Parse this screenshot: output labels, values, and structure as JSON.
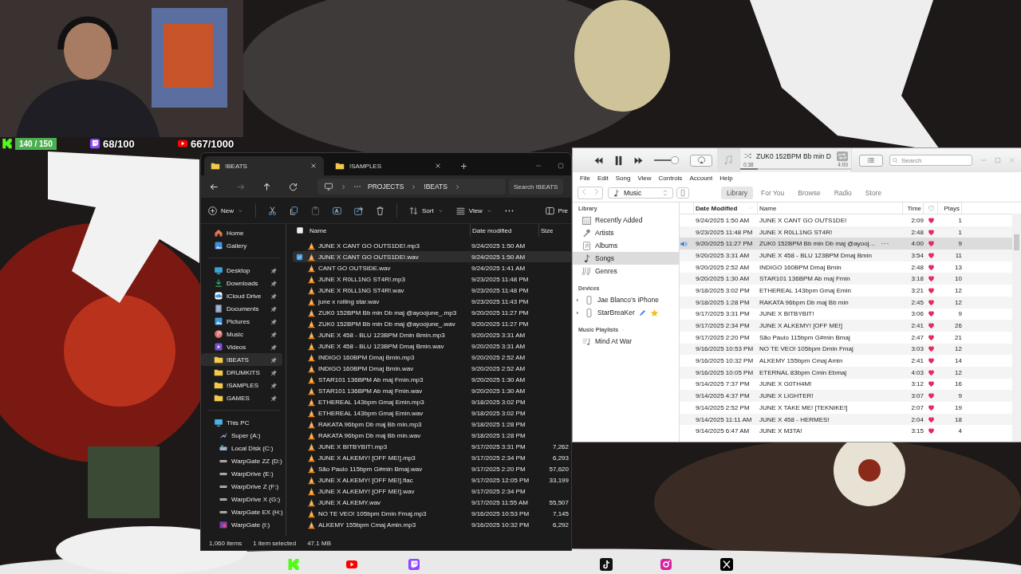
{
  "stream": {
    "goals": [
      {
        "kind": "kick",
        "count": "140 / 150"
      },
      {
        "kind": "twitch",
        "count": "68/100"
      },
      {
        "kind": "youtube",
        "count": "667/1000"
      }
    ],
    "socials": [
      {
        "kind": "kick"
      },
      {
        "kind": "youtube"
      },
      {
        "kind": "twitch"
      },
      {
        "kind": "tiktok"
      },
      {
        "kind": "instagram"
      },
      {
        "kind": "x"
      }
    ]
  },
  "explorer": {
    "tabs": [
      {
        "label": "!BEATS",
        "selected": true
      },
      {
        "label": "!SAMPLES",
        "selected": false
      }
    ],
    "breadcrumb": [
      "PROJECTS",
      "!BEATS"
    ],
    "search": {
      "placeholder": "Search !BEATS"
    },
    "toolbar": {
      "new": "New",
      "sort": "Sort",
      "view": "View",
      "preview": "Pre"
    },
    "columns": [
      "Name",
      "Date modified",
      "Size"
    ],
    "sidebar": [
      {
        "items": [
          {
            "label": "Home",
            "kind": "home",
            "pinned": false,
            "selected": false
          },
          {
            "label": "Gallery",
            "kind": "gallery",
            "pinned": false,
            "selected": false
          }
        ]
      },
      {
        "items": [
          {
            "label": "Desktop",
            "kind": "desktop",
            "pinned": true,
            "selected": false
          },
          {
            "label": "Downloads",
            "kind": "downloads",
            "pinned": true,
            "selected": false
          },
          {
            "label": "iCloud Drive",
            "kind": "cloud",
            "pinned": true,
            "selected": false
          },
          {
            "label": "Documents",
            "kind": "documents",
            "pinned": true,
            "selected": false
          },
          {
            "label": "Pictures",
            "kind": "pictures",
            "pinned": true,
            "selected": false
          },
          {
            "label": "Music",
            "kind": "music",
            "pinned": true,
            "selected": false
          },
          {
            "label": "Videos",
            "kind": "videos",
            "pinned": true,
            "selected": false
          },
          {
            "label": "!BEATS",
            "kind": "folder",
            "pinned": true,
            "selected": true
          },
          {
            "label": "DRUMKITS",
            "kind": "folder",
            "pinned": true,
            "selected": false
          },
          {
            "label": "!SAMPLES",
            "kind": "folder",
            "pinned": true,
            "selected": false
          },
          {
            "label": "GAMES",
            "kind": "folder",
            "pinned": true,
            "selected": false
          }
        ]
      },
      {
        "items": [
          {
            "label": "This PC",
            "kind": "pc",
            "selected": false,
            "children": [
              {
                "label": "Super (A:)",
                "kind": "special",
                "selected": false
              },
              {
                "label": "Local Disk (C:)",
                "kind": "disk",
                "selected": false
              },
              {
                "label": "WarpGate ZZ (D:)",
                "kind": "drive",
                "selected": false
              },
              {
                "label": "WarpDrive (E:)",
                "kind": "drive",
                "selected": false
              },
              {
                "label": "WarpDrive Z (F:)",
                "kind": "drive",
                "selected": false
              },
              {
                "label": "WarpDrive X (G:)",
                "kind": "drive",
                "selected": false
              },
              {
                "label": "WarpGate EX (H:)",
                "kind": "drive",
                "selected": false
              },
              {
                "label": "WarpGate (I:)",
                "kind": "app",
                "selected": false
              }
            ]
          }
        ]
      }
    ],
    "files": [
      {
        "name": "JUNE X CANT GO OUTS1DE!.mp3",
        "date": "9/24/2025 1:50 AM",
        "selected": false
      },
      {
        "name": "JUNE X CANT GO OUTS1DE!.wav",
        "date": "9/24/2025 1:50 AM",
        "selected": true
      },
      {
        "name": "CANT GO OUTSIDE.wav",
        "date": "9/24/2025 1:41 AM",
        "selected": false
      },
      {
        "name": "JUNE X R0LL1NG ST4R!.mp3",
        "date": "9/23/2025 11:48 PM",
        "selected": false
      },
      {
        "name": "JUNE X R0LL1NG ST4R!.wav",
        "date": "9/23/2025 11:48 PM",
        "selected": false
      },
      {
        "name": "june x rolling star.wav",
        "date": "9/23/2025 11:43 PM",
        "selected": false
      },
      {
        "name": "ZUK0 152BPM Bb min Db maj @ayoojune_.mp3",
        "date": "9/20/2025 11:27 PM",
        "selected": false
      },
      {
        "name": "ZUK0 152BPM Bb min Db maj @ayoojune_.wav",
        "date": "9/20/2025 11:27 PM",
        "selected": false
      },
      {
        "name": "JUNE X 458 - BLU 123BPM Dmin Bmin.mp3",
        "date": "9/20/2025 3:31 AM",
        "selected": false
      },
      {
        "name": "JUNE X 458 - BLU 123BPM Dmaj Bmin.wav",
        "date": "9/20/2025 3:31 AM",
        "selected": false
      },
      {
        "name": "INDIGO 160BPM Dmaj Bmin.mp3",
        "date": "9/20/2025 2:52 AM",
        "selected": false
      },
      {
        "name": "INDIGO 160BPM Dmaj Bmin.wav",
        "date": "9/20/2025 2:52 AM",
        "selected": false
      },
      {
        "name": "STAR101 136BPM Ab maj Fmin.mp3",
        "date": "9/20/2025 1:30 AM",
        "selected": false
      },
      {
        "name": "STAR101 136BPM Ab maj Fmin.wav",
        "date": "9/20/2025 1:30 AM",
        "selected": false
      },
      {
        "name": "ETHEREAL 143bpm Gmaj Emin.mp3",
        "date": "9/18/2025 3:02 PM",
        "selected": false
      },
      {
        "name": "ETHEREAL 143bpm Gmaj Emin.wav",
        "date": "9/18/2025 3:02 PM",
        "selected": false
      },
      {
        "name": "RAKATA 96bpm Db maj Bb min.mp3",
        "date": "9/18/2025 1:28 PM",
        "selected": false
      },
      {
        "name": "RAKATA 96bpm Db maj Bb min.wav",
        "date": "9/18/2025 1:28 PM",
        "selected": false
      },
      {
        "name": "JUNE X BITBYBIT!.mp3",
        "date": "9/17/2025 3:31 PM",
        "size": "7,262",
        "selected": false
      },
      {
        "name": "JUNE X ALKEMY! [OFF ME!].mp3",
        "date": "9/17/2025 2:34 PM",
        "size": "6,293",
        "selected": false
      },
      {
        "name": "São Paulo 115bpm G#min Bmaj.wav",
        "date": "9/17/2025 2:20 PM",
        "size": "57,620",
        "selected": false
      },
      {
        "name": "JUNE X ALKEMY! [OFF ME!].flac",
        "date": "9/17/2025 12:05 PM",
        "size": "33,199",
        "selected": false
      },
      {
        "name": "JUNE X ALKEMY! [OFF ME!].wav",
        "date": "9/17/2025 2:34 PM",
        "selected": false
      },
      {
        "name": "JUNE X ALKEMY.wav",
        "date": "9/17/2025 11:55 AM",
        "size": "55,507",
        "selected": false
      },
      {
        "name": "NO TE VEO! 105bpm Dmin Fmaj.mp3",
        "date": "9/16/2025 10:53 PM",
        "size": "7,145",
        "selected": false
      },
      {
        "name": "ALKEMY 155bpm Cmaj Amin.mp3",
        "date": "9/16/2025 10:32 PM",
        "size": "6,292",
        "selected": false
      }
    ],
    "status": [
      "1,060 items",
      "1 item selected",
      "47.1 MB"
    ]
  },
  "itunes": {
    "volume": {
      "level": 0.85
    },
    "now_playing": {
      "title": "ZUK0 152BPM Bb min D",
      "elapsed": "0:38",
      "total": "4:00",
      "level": 0.16
    },
    "search": {
      "placeholder": "Search"
    },
    "menu": [
      "File",
      "Edit",
      "Song",
      "View",
      "Controls",
      "Account",
      "Help"
    ],
    "source": "Music",
    "tabs": [
      {
        "label": "Library",
        "selected": true
      },
      {
        "label": "For You",
        "selected": false
      },
      {
        "label": "Browse",
        "selected": false
      },
      {
        "label": "Radio",
        "selected": false
      },
      {
        "label": "Store",
        "selected": false
      }
    ],
    "sidebar": [
      {
        "heading": "Library",
        "items": [
          {
            "label": "Recently Added",
            "kind": "recent",
            "selected": false
          },
          {
            "label": "Artists",
            "kind": "artists",
            "selected": false
          },
          {
            "label": "Albums",
            "kind": "albums",
            "selected": false
          },
          {
            "label": "Songs",
            "kind": "songs",
            "selected": true
          },
          {
            "label": "Genres",
            "kind": "genres",
            "selected": false
          }
        ]
      },
      {
        "heading": "Devices",
        "items": [
          {
            "label": "Jae Blanco’s iPhone",
            "kind": "device",
            "expanded": false,
            "emoji_icons": false,
            "selected": false
          },
          {
            "label": "StarBreaKer",
            "kind": "device",
            "expanded": false,
            "emoji_icons": true,
            "selected": false
          }
        ]
      },
      {
        "heading": "Music Playlists",
        "collapsible": true,
        "items": [
          {
            "label": "Mind At War",
            "kind": "playlist",
            "selected": false
          }
        ]
      }
    ],
    "columns": [
      {
        "label": "Date Modified",
        "sorted": true
      },
      {
        "label": "Name",
        "sorted": false
      },
      {
        "label": "Time",
        "sorted": false
      },
      {
        "label": "Plays",
        "sorted": false
      }
    ],
    "songs": [
      {
        "date": "9/24/2025 1:50 AM",
        "name": "JUNE X CANT GO OUTS1DE!",
        "time": "2:09",
        "loved": true,
        "plays": "1",
        "playing": false
      },
      {
        "date": "9/23/2025 11:48 PM",
        "name": "JUNE X R0LL1NG ST4R!",
        "time": "2:48",
        "loved": true,
        "plays": "1",
        "playing": false
      },
      {
        "date": "9/20/2025 11:27 PM",
        "name": "ZUK0 152BPM Bb min Db maj @ayooj…",
        "time": "4:00",
        "loved": true,
        "plays": "9",
        "playing": true
      },
      {
        "date": "9/20/2025 3:31 AM",
        "name": "JUNE X 458 - BLU 123BPM Dmaj Bmin",
        "time": "3:54",
        "loved": true,
        "plays": "11",
        "playing": false
      },
      {
        "date": "9/20/2025 2:52 AM",
        "name": "INDIGO 160BPM Dmaj Bmin",
        "time": "2:48",
        "loved": true,
        "plays": "13",
        "playing": false
      },
      {
        "date": "9/20/2025 1:30 AM",
        "name": "STAR101 136BPM Ab maj Fmin",
        "time": "3:18",
        "loved": true,
        "plays": "10",
        "playing": false
      },
      {
        "date": "9/18/2025 3:02 PM",
        "name": "ETHEREAL 143bpm Gmaj Emin",
        "time": "3:21",
        "loved": true,
        "plays": "12",
        "playing": false
      },
      {
        "date": "9/18/2025 1:28 PM",
        "name": "RAKATA 96bpm Db maj Bb min",
        "time": "2:45",
        "loved": true,
        "plays": "12",
        "playing": false
      },
      {
        "date": "9/17/2025 3:31 PM",
        "name": "JUNE X BITBYBIT!",
        "time": "3:06",
        "loved": true,
        "plays": "9",
        "playing": false
      },
      {
        "date": "9/17/2025 2:34 PM",
        "name": "JUNE X ALKEMY! [OFF ME!]",
        "time": "2:41",
        "loved": true,
        "plays": "26",
        "playing": false
      },
      {
        "date": "9/17/2025 2:20 PM",
        "name": "São Paulo 115bpm G#min Bmaj",
        "time": "2:47",
        "loved": true,
        "plays": "21",
        "playing": false
      },
      {
        "date": "9/16/2025 10:53 PM",
        "name": "NO TE VEO! 105bpm Dmin Fmaj",
        "time": "3:03",
        "loved": true,
        "plays": "12",
        "playing": false
      },
      {
        "date": "9/16/2025 10:32 PM",
        "name": "ALKEMY 155bpm Cmaj Amin",
        "time": "2:41",
        "loved": true,
        "plays": "14",
        "playing": false
      },
      {
        "date": "9/16/2025 10:05 PM",
        "name": "ETERNAL 83bpm Cmin Ebmaj",
        "time": "4:03",
        "loved": true,
        "plays": "12",
        "playing": false
      },
      {
        "date": "9/14/2025 7:37 PM",
        "name": "JUNE X G0TH4M!",
        "time": "3:12",
        "loved": true,
        "plays": "16",
        "playing": false
      },
      {
        "date": "9/14/2025 4:37 PM",
        "name": "JUNE X LIGHTER!",
        "time": "3:07",
        "loved": true,
        "plays": "9",
        "playing": false
      },
      {
        "date": "9/14/2025 2:52 PM",
        "name": "JUNE X TAKE ME! [TEKNIKE!]",
        "time": "2:07",
        "loved": true,
        "plays": "19",
        "playing": false
      },
      {
        "date": "9/14/2025 11:11 AM",
        "name": "JUNE X 458 - HERMES!",
        "time": "2:04",
        "loved": true,
        "plays": "18",
        "playing": false
      },
      {
        "date": "9/14/2025 6:47 AM",
        "name": "JUNE X M3TA!",
        "time": "3:15",
        "loved": true,
        "plays": "4",
        "playing": false
      }
    ]
  }
}
